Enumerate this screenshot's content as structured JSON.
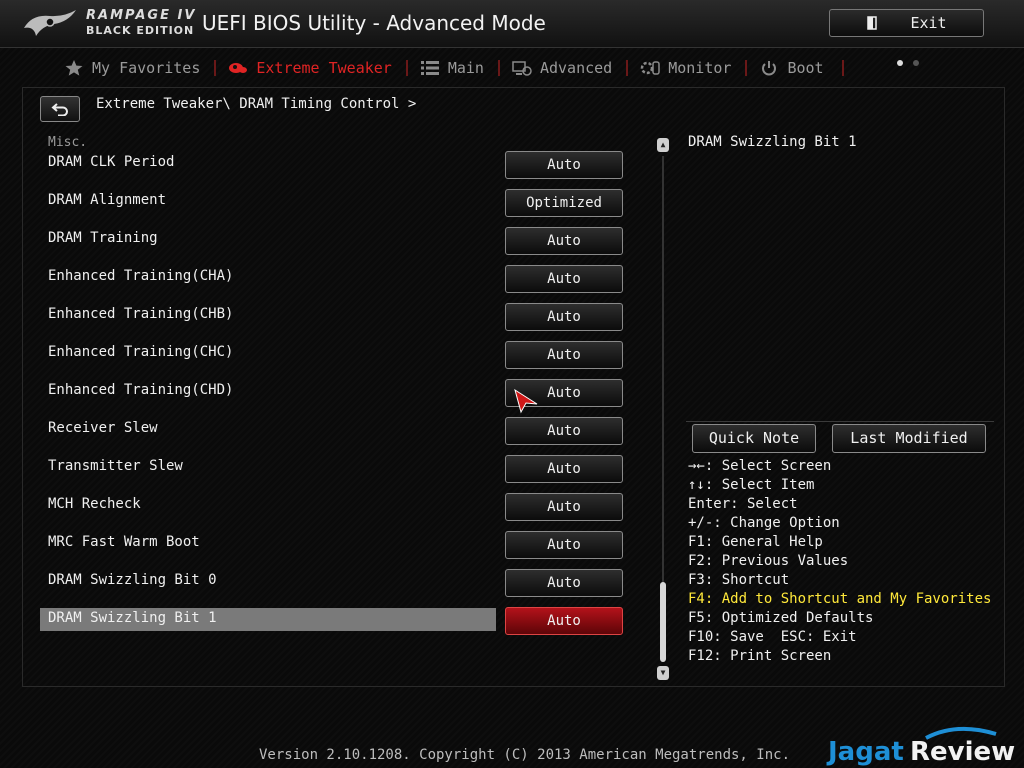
{
  "header": {
    "brand_line1": "RAMPAGE IV",
    "brand_line2": "BLACK EDITION",
    "title": "UEFI BIOS Utility - Advanced Mode",
    "exit_label": "Exit"
  },
  "tabs": [
    {
      "label": "My Favorites",
      "icon": "star-icon"
    },
    {
      "label": "Extreme Tweaker",
      "icon": "tweaker-icon",
      "active": true
    },
    {
      "label": "Main",
      "icon": "list-icon"
    },
    {
      "label": "Advanced",
      "icon": "advanced-icon"
    },
    {
      "label": "Monitor",
      "icon": "monitor-icon"
    },
    {
      "label": "Boot",
      "icon": "power-icon"
    }
  ],
  "breadcrumb": "Extreme Tweaker\\ DRAM Timing Control >",
  "section_label": "Misc.",
  "settings": [
    {
      "label": "DRAM CLK Period",
      "value": "Auto"
    },
    {
      "label": "DRAM Alignment",
      "value": "Optimized"
    },
    {
      "label": "DRAM Training",
      "value": "Auto"
    },
    {
      "label": "Enhanced Training(CHA)",
      "value": "Auto"
    },
    {
      "label": "Enhanced Training(CHB)",
      "value": "Auto"
    },
    {
      "label": "Enhanced Training(CHC)",
      "value": "Auto"
    },
    {
      "label": "Enhanced Training(CHD)",
      "value": "Auto"
    },
    {
      "label": "Receiver Slew",
      "value": "Auto"
    },
    {
      "label": "Transmitter Slew",
      "value": "Auto"
    },
    {
      "label": "MCH Recheck",
      "value": "Auto"
    },
    {
      "label": "MRC Fast Warm Boot",
      "value": "Auto"
    },
    {
      "label": "DRAM Swizzling Bit 0",
      "value": "Auto"
    },
    {
      "label": "DRAM Swizzling Bit 1",
      "value": "Auto",
      "selected": true
    }
  ],
  "help": {
    "title": "DRAM Swizzling Bit 1",
    "quick_note": "Quick Note",
    "last_modified": "Last Modified",
    "keys": [
      {
        "text": "→←: Select Screen"
      },
      {
        "text": "↑↓: Select Item"
      },
      {
        "text": "Enter: Select"
      },
      {
        "text": "+/-: Change Option"
      },
      {
        "text": "F1: General Help"
      },
      {
        "text": "F2: Previous Values"
      },
      {
        "text": "F3: Shortcut"
      },
      {
        "text": "F4: Add to Shortcut and My Favorites",
        "highlight": true
      },
      {
        "text": "F5: Optimized Defaults"
      },
      {
        "text": "F10: Save  ESC: Exit"
      },
      {
        "text": "F12: Print Screen"
      }
    ]
  },
  "footer": "Version 2.10.1208. Copyright (C) 2013 American Megatrends, Inc.",
  "watermark": {
    "part1": "Jagat",
    "part2": "Review"
  },
  "colors": {
    "accent_red": "#e02424",
    "selected_value": "#b3121a",
    "highlight_key": "#ffe83a",
    "watermark_blue": "#1e8fd6"
  }
}
